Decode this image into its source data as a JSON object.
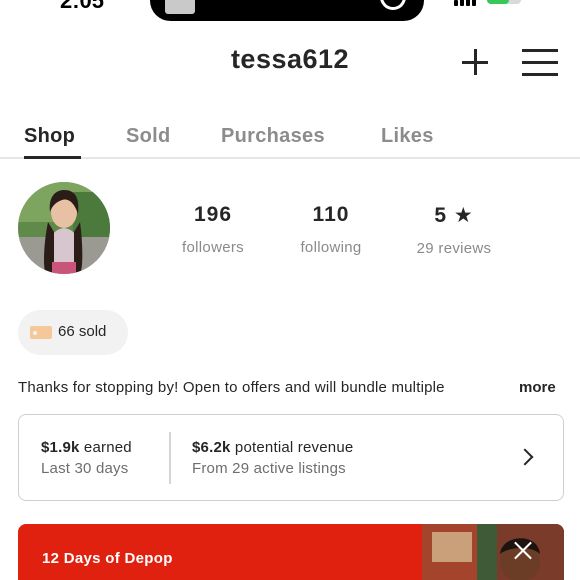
{
  "status_bar": {
    "time": "2:05",
    "icons": [
      "signal-icon",
      "battery-icon"
    ],
    "battery_color": "#38c759"
  },
  "header": {
    "username": "tessa612",
    "icons": [
      "plus-icon",
      "menu-icon"
    ]
  },
  "tabs": [
    {
      "label": "Shop",
      "active": true
    },
    {
      "label": "Sold",
      "active": false
    },
    {
      "label": "Purchases",
      "active": false
    },
    {
      "label": "Likes",
      "active": false
    }
  ],
  "profile": {
    "stats": [
      {
        "value": "196",
        "label": "followers"
      },
      {
        "value": "110",
        "label": "following"
      },
      {
        "value": "5 ★",
        "label": "29 reviews"
      }
    ]
  },
  "sold_badge": {
    "icon": "price-tag-icon",
    "text": "66 sold"
  },
  "bio": {
    "text": "Thanks for stopping by! Open to offers and will bundle multiple",
    "more_label": "more"
  },
  "earnings": {
    "earned_amount": "$1.9k",
    "earned_label": "earned",
    "earned_period": "Last 30 days",
    "potential_amount": "$6.2k",
    "potential_label": "potential revenue",
    "potential_source": "From 29 active listings"
  },
  "promo": {
    "title": "12 Days of Depop",
    "background_color": "#e0210f"
  },
  "colors": {
    "text": "#262626",
    "muted": "#8a8a8a",
    "accent": "#e0210f"
  }
}
